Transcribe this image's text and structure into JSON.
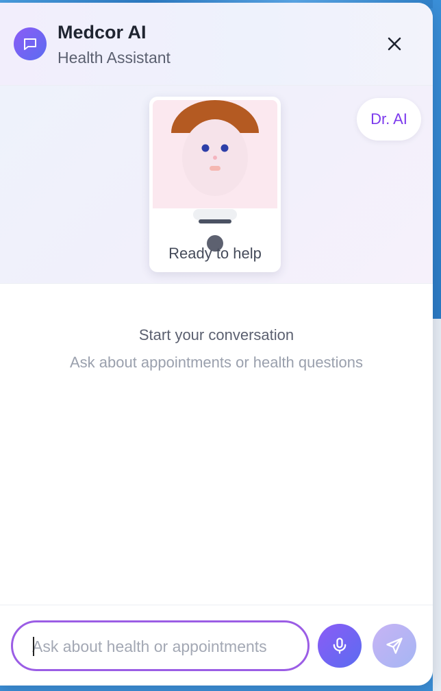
{
  "header": {
    "title": "Medcor AI",
    "subtitle": "Health Assistant",
    "logo_icon": "chat-bubble-icon",
    "close_icon": "close-icon"
  },
  "avatar": {
    "status": "Ready to help",
    "badge": "Dr. AI"
  },
  "conversation": {
    "empty_title": "Start your conversation",
    "empty_subtitle": "Ask about appointments or health questions"
  },
  "composer": {
    "input_value": "",
    "placeholder": "Ask about health or appointments",
    "mic_icon": "microphone-icon",
    "send_icon": "send-icon"
  },
  "colors": {
    "accent_purple": "#8b5cf6",
    "accent_blue": "#5b6cf0",
    "badge_text": "#7c3aed",
    "input_border": "#9b5de5"
  }
}
